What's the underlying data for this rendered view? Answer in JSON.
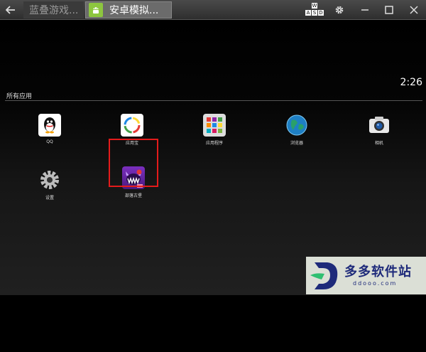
{
  "titlebar": {
    "tabs": [
      {
        "label": "蓝叠游戏..."
      },
      {
        "label": "安卓模拟..."
      }
    ],
    "keymap": {
      "w": "W",
      "a": "A",
      "s": "S",
      "d": "D"
    }
  },
  "home": {
    "clock": "2:26",
    "section_label": "所有应用",
    "apps": [
      {
        "label": "QQ",
        "icon": "qq-icon"
      },
      {
        "label": "应用宝",
        "icon": "app-store-icon"
      },
      {
        "label": "应用程序",
        "icon": "apps-grid-icon"
      },
      {
        "label": "浏览器",
        "icon": "browser-globe-icon"
      },
      {
        "label": "相机",
        "icon": "camera-icon"
      },
      {
        "label": "设置",
        "icon": "settings-gear-icon"
      },
      {
        "label": "部落古堡",
        "icon": "game-monster-icon"
      }
    ]
  },
  "watermark": {
    "brand": "多多软件站",
    "url": "ddooo.com"
  },
  "colors": {
    "highlight": "#e41b1b",
    "android_green": "#8dc63f",
    "watermark_blue": "#1e2a7a"
  }
}
